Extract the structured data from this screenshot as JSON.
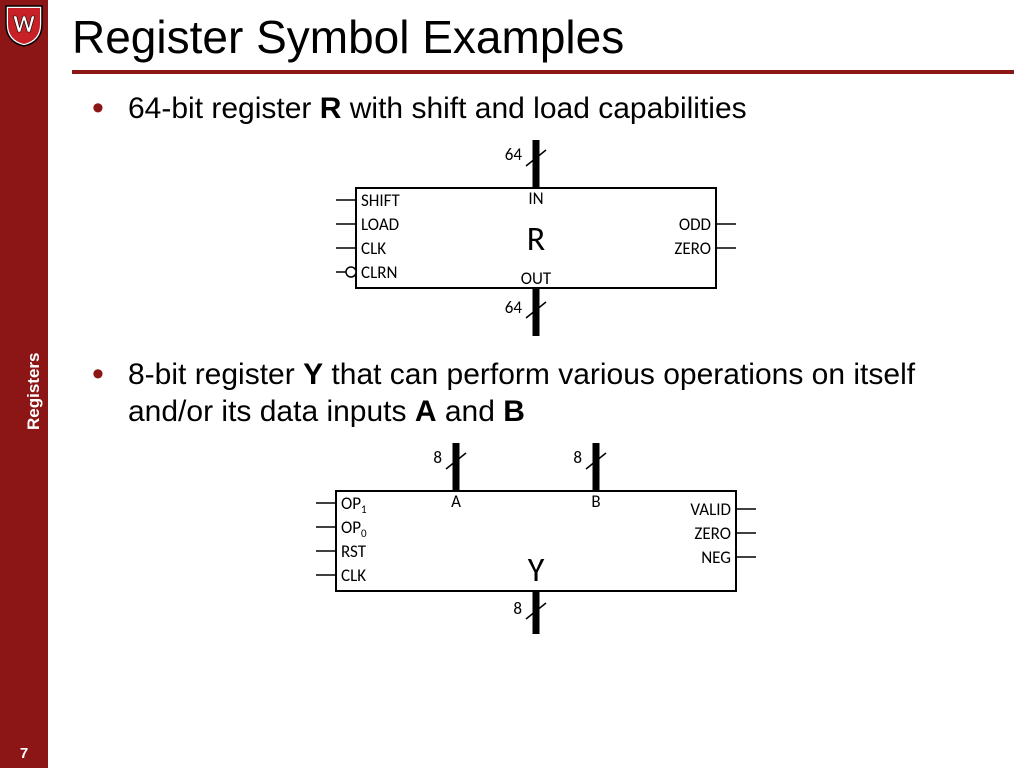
{
  "sidebar": {
    "section_label": "Registers",
    "page_number": "7"
  },
  "title": "Register Symbol Examples",
  "bullets": {
    "b1_pre": "64-bit register ",
    "b1_bold": "R",
    "b1_post": " with shift and load capabilities",
    "b2_pre": "8-bit register ",
    "b2_bold1": "Y",
    "b2_mid": " that can perform various operations on itself and/or its data inputs ",
    "b2_bold2": "A",
    "b2_and": " and ",
    "b2_bold3": "B"
  },
  "regR": {
    "name": "R",
    "bus_top": "64",
    "bus_bot": "64",
    "in_top": "IN",
    "out_bot": "OUT",
    "left_pins": [
      "SHIFT",
      "LOAD",
      "CLK",
      "CLRN"
    ],
    "right_pins": [
      "ODD",
      "ZERO"
    ]
  },
  "regY": {
    "name": "Y",
    "bus_a": "8",
    "bus_b": "8",
    "bus_out": "8",
    "a_label": "A",
    "b_label": "B",
    "left_pins": [
      "OP",
      "OP",
      "RST",
      "CLK"
    ],
    "left_pin_subs": [
      "1",
      "0",
      "",
      ""
    ],
    "right_pins": [
      "VALID",
      "ZERO",
      "NEG"
    ]
  }
}
